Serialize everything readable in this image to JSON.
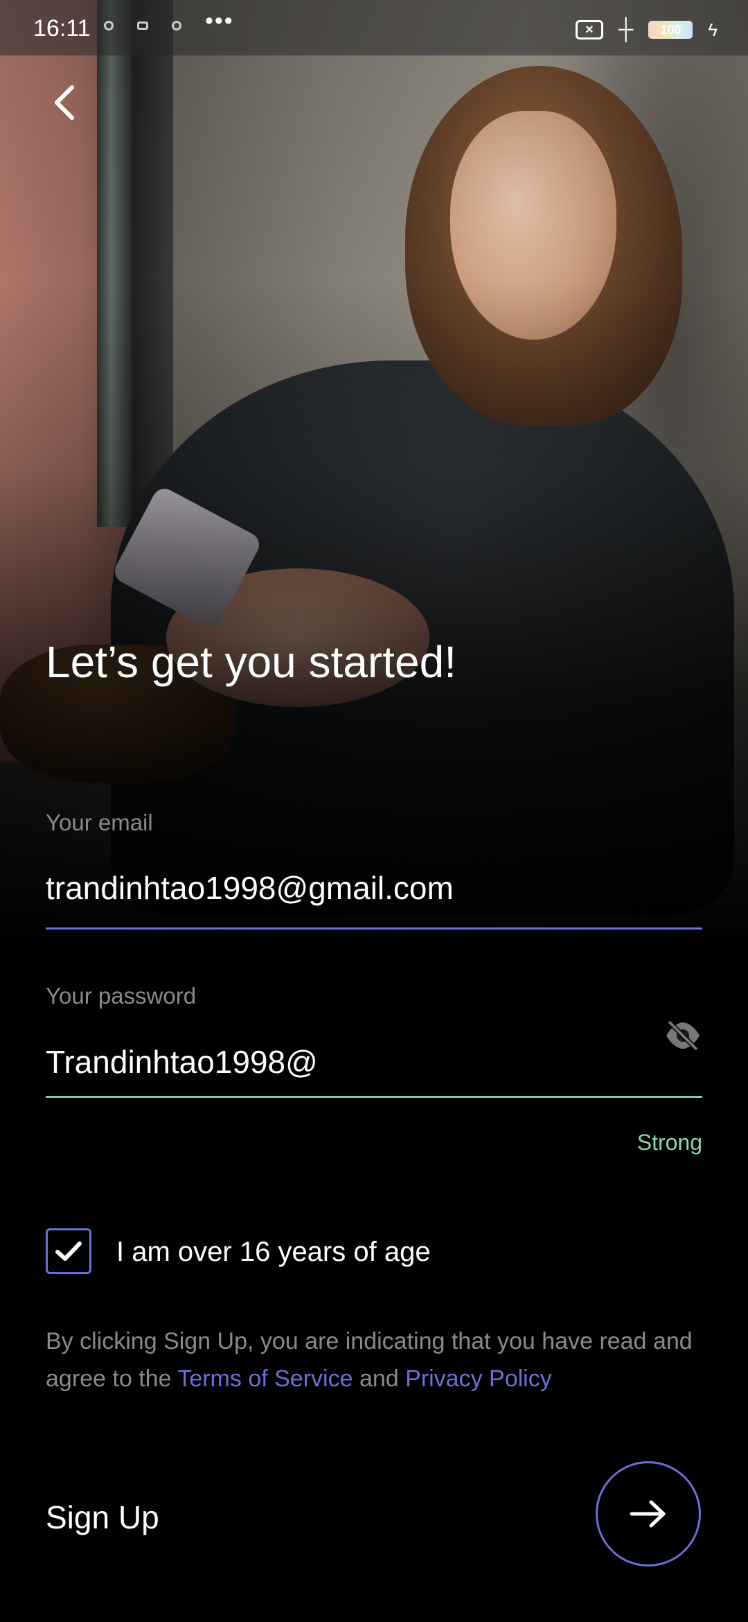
{
  "status_bar": {
    "time": "16:11",
    "more": "•••",
    "battery": "100",
    "icons": [
      "focus-icon",
      "game-icon",
      "sync-icon",
      "screen-record-stop-icon",
      "signal-icon",
      "battery-icon",
      "charging-bolt-icon"
    ]
  },
  "nav": {
    "back_icon": "chevron-left-icon"
  },
  "headline": "Let’s get you started!",
  "email": {
    "label": "Your email",
    "value": "trandinhtao1998@gmail.com",
    "accent": "#6b6fd8"
  },
  "password": {
    "label": "Your password",
    "value": "Trandinhtao1998@",
    "visibility_icon": "eye-off-icon",
    "strength": "Strong",
    "strength_color": "#86d9a6"
  },
  "age_check": {
    "checked": true,
    "label": "I am over 16 years of age"
  },
  "terms": {
    "prefix": "By clicking Sign Up, you are indicating that you have read and agree to the ",
    "tos": "Terms of Service",
    "and": " and ",
    "privacy": "Privacy Policy"
  },
  "signup": {
    "label": "Sign Up",
    "button_icon": "arrow-right-icon"
  }
}
